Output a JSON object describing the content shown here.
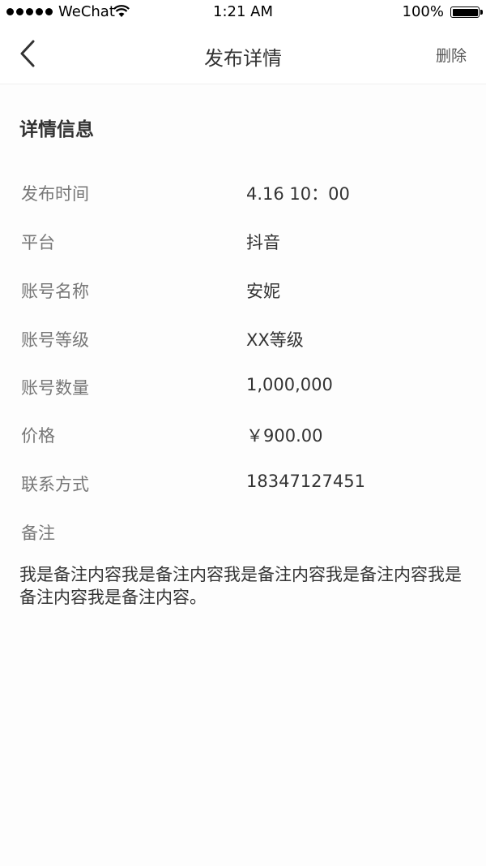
{
  "status_bar": {
    "carrier": "WeChat",
    "time": "1:21 AM",
    "battery": "100%",
    "battery_level": 1.0
  },
  "nav": {
    "title": "发布详情",
    "delete_label": "删除"
  },
  "section_title": "详情信息",
  "details": [
    {
      "label": "发布时间",
      "value": "4.16 10：00"
    },
    {
      "label": "平台",
      "value": "抖音"
    },
    {
      "label": "账号名称",
      "value": "安妮"
    },
    {
      "label": "账号等级",
      "value": "XX等级"
    },
    {
      "label": "账号数量",
      "value": "1,000,000"
    },
    {
      "label": "价格",
      "value": "￥900.00"
    },
    {
      "label": "联系方式",
      "value": "18347127451"
    }
  ],
  "remark": {
    "label": "备注",
    "content": "我是备注内容我是备注内容我是备注内容我是备注内容我是备注内容我是备注内容。"
  }
}
